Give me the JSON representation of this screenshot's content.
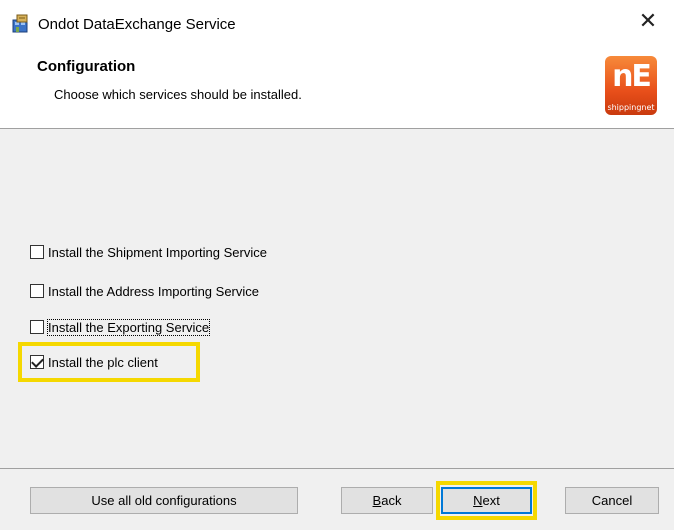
{
  "window": {
    "title": "Ondot DataExchange Service",
    "close_symbol": "✕"
  },
  "header": {
    "title": "Configuration",
    "subtitle": "Choose which services should be installed.",
    "logo": {
      "mark": "nE",
      "text": "shippingnet"
    }
  },
  "options": [
    {
      "label": "Install the Shipment Importing Service",
      "checked": false
    },
    {
      "label": "Install the Address Importing Service",
      "checked": false
    },
    {
      "label": "Install the Exporting Service",
      "checked": false
    },
    {
      "label": "Install the plc client",
      "checked": true
    }
  ],
  "buttons": {
    "use_old": "Use all old configurations",
    "back_accel": "B",
    "back_rest": "ack",
    "next_accel": "N",
    "next_rest": "ext",
    "cancel": "Cancel"
  },
  "colors": {
    "highlight": "#f5d800",
    "logo_orange": "#e84f1a"
  }
}
